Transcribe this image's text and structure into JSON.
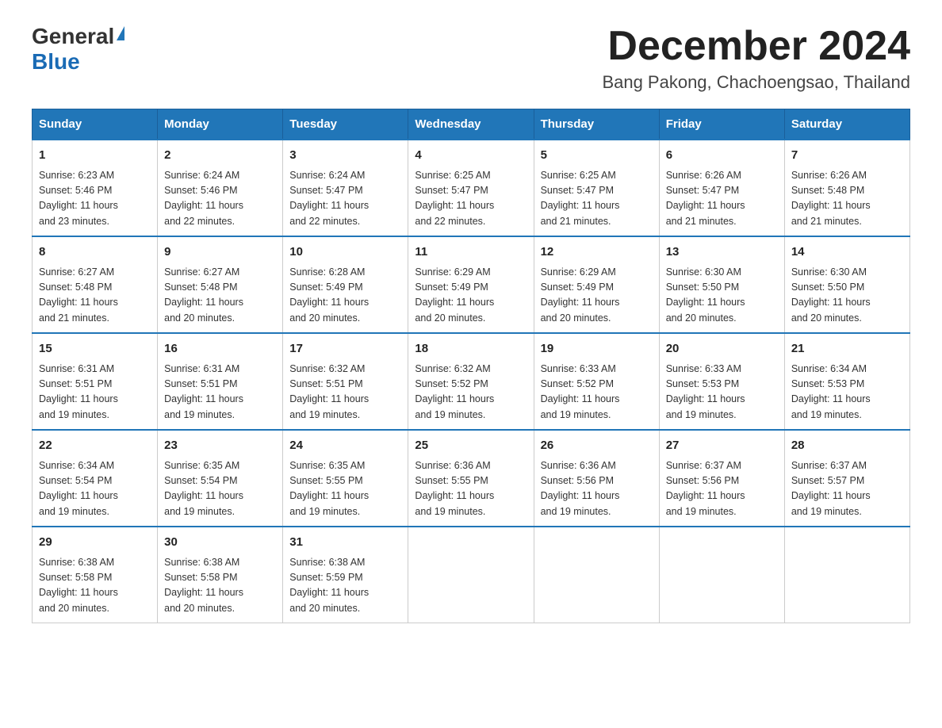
{
  "header": {
    "logo_general": "General",
    "logo_blue": "Blue",
    "title": "December 2024",
    "subtitle": "Bang Pakong, Chachoengsao, Thailand"
  },
  "days_of_week": [
    "Sunday",
    "Monday",
    "Tuesday",
    "Wednesday",
    "Thursday",
    "Friday",
    "Saturday"
  ],
  "weeks": [
    [
      {
        "day": "1",
        "sunrise": "6:23 AM",
        "sunset": "5:46 PM",
        "daylight": "11 hours and 23 minutes."
      },
      {
        "day": "2",
        "sunrise": "6:24 AM",
        "sunset": "5:46 PM",
        "daylight": "11 hours and 22 minutes."
      },
      {
        "day": "3",
        "sunrise": "6:24 AM",
        "sunset": "5:47 PM",
        "daylight": "11 hours and 22 minutes."
      },
      {
        "day": "4",
        "sunrise": "6:25 AM",
        "sunset": "5:47 PM",
        "daylight": "11 hours and 22 minutes."
      },
      {
        "day": "5",
        "sunrise": "6:25 AM",
        "sunset": "5:47 PM",
        "daylight": "11 hours and 21 minutes."
      },
      {
        "day": "6",
        "sunrise": "6:26 AM",
        "sunset": "5:47 PM",
        "daylight": "11 hours and 21 minutes."
      },
      {
        "day": "7",
        "sunrise": "6:26 AM",
        "sunset": "5:48 PM",
        "daylight": "11 hours and 21 minutes."
      }
    ],
    [
      {
        "day": "8",
        "sunrise": "6:27 AM",
        "sunset": "5:48 PM",
        "daylight": "11 hours and 21 minutes."
      },
      {
        "day": "9",
        "sunrise": "6:27 AM",
        "sunset": "5:48 PM",
        "daylight": "11 hours and 20 minutes."
      },
      {
        "day": "10",
        "sunrise": "6:28 AM",
        "sunset": "5:49 PM",
        "daylight": "11 hours and 20 minutes."
      },
      {
        "day": "11",
        "sunrise": "6:29 AM",
        "sunset": "5:49 PM",
        "daylight": "11 hours and 20 minutes."
      },
      {
        "day": "12",
        "sunrise": "6:29 AM",
        "sunset": "5:49 PM",
        "daylight": "11 hours and 20 minutes."
      },
      {
        "day": "13",
        "sunrise": "6:30 AM",
        "sunset": "5:50 PM",
        "daylight": "11 hours and 20 minutes."
      },
      {
        "day": "14",
        "sunrise": "6:30 AM",
        "sunset": "5:50 PM",
        "daylight": "11 hours and 20 minutes."
      }
    ],
    [
      {
        "day": "15",
        "sunrise": "6:31 AM",
        "sunset": "5:51 PM",
        "daylight": "11 hours and 19 minutes."
      },
      {
        "day": "16",
        "sunrise": "6:31 AM",
        "sunset": "5:51 PM",
        "daylight": "11 hours and 19 minutes."
      },
      {
        "day": "17",
        "sunrise": "6:32 AM",
        "sunset": "5:51 PM",
        "daylight": "11 hours and 19 minutes."
      },
      {
        "day": "18",
        "sunrise": "6:32 AM",
        "sunset": "5:52 PM",
        "daylight": "11 hours and 19 minutes."
      },
      {
        "day": "19",
        "sunrise": "6:33 AM",
        "sunset": "5:52 PM",
        "daylight": "11 hours and 19 minutes."
      },
      {
        "day": "20",
        "sunrise": "6:33 AM",
        "sunset": "5:53 PM",
        "daylight": "11 hours and 19 minutes."
      },
      {
        "day": "21",
        "sunrise": "6:34 AM",
        "sunset": "5:53 PM",
        "daylight": "11 hours and 19 minutes."
      }
    ],
    [
      {
        "day": "22",
        "sunrise": "6:34 AM",
        "sunset": "5:54 PM",
        "daylight": "11 hours and 19 minutes."
      },
      {
        "day": "23",
        "sunrise": "6:35 AM",
        "sunset": "5:54 PM",
        "daylight": "11 hours and 19 minutes."
      },
      {
        "day": "24",
        "sunrise": "6:35 AM",
        "sunset": "5:55 PM",
        "daylight": "11 hours and 19 minutes."
      },
      {
        "day": "25",
        "sunrise": "6:36 AM",
        "sunset": "5:55 PM",
        "daylight": "11 hours and 19 minutes."
      },
      {
        "day": "26",
        "sunrise": "6:36 AM",
        "sunset": "5:56 PM",
        "daylight": "11 hours and 19 minutes."
      },
      {
        "day": "27",
        "sunrise": "6:37 AM",
        "sunset": "5:56 PM",
        "daylight": "11 hours and 19 minutes."
      },
      {
        "day": "28",
        "sunrise": "6:37 AM",
        "sunset": "5:57 PM",
        "daylight": "11 hours and 19 minutes."
      }
    ],
    [
      {
        "day": "29",
        "sunrise": "6:38 AM",
        "sunset": "5:58 PM",
        "daylight": "11 hours and 20 minutes."
      },
      {
        "day": "30",
        "sunrise": "6:38 AM",
        "sunset": "5:58 PM",
        "daylight": "11 hours and 20 minutes."
      },
      {
        "day": "31",
        "sunrise": "6:38 AM",
        "sunset": "5:59 PM",
        "daylight": "11 hours and 20 minutes."
      },
      null,
      null,
      null,
      null
    ]
  ],
  "labels": {
    "sunrise": "Sunrise:",
    "sunset": "Sunset:",
    "daylight": "Daylight:"
  },
  "colors": {
    "header_bg": "#2176b8",
    "header_border": "#1a5f9a",
    "logo_blue": "#1a6bb5",
    "cell_border_top": "#2176b8"
  }
}
